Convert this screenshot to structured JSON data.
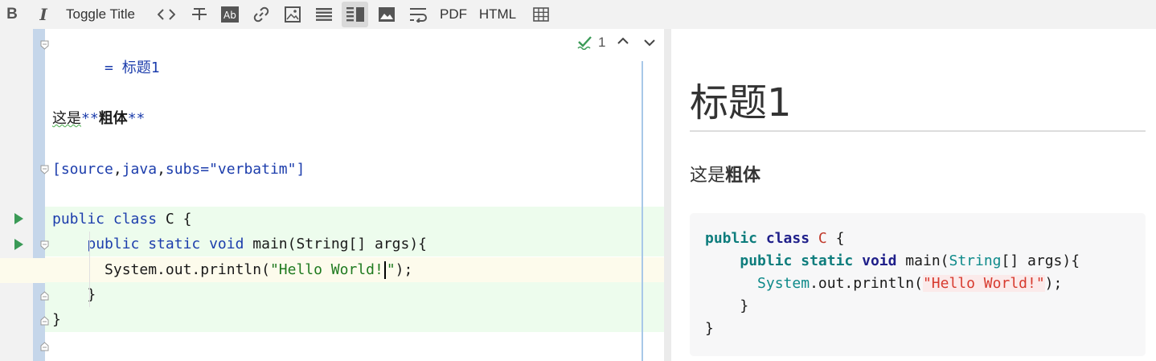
{
  "toolbar": {
    "bold": "B",
    "italic": "I",
    "toggle_title": "Toggle Title",
    "pdf": "PDF",
    "html": "HTML"
  },
  "editor": {
    "heading_line": "= 标题1",
    "para_prefix": "这是",
    "para_bold_open": "**",
    "para_bold_text": "粗体",
    "para_bold_close": "**",
    "attr_open": "[source",
    "attr_c1": ",",
    "attr_java": "java",
    "attr_c2": ",",
    "attr_subs": "subs=\"verbatim\"]",
    "delim_top": "----",
    "code_l1_kw1": "public",
    "code_l1_kw2": "class",
    "code_l1_rest": "C {",
    "code_l2_indent": "    ",
    "code_l2_kw": "public static void",
    "code_l2_rest": "main(String[] args){",
    "code_l3_indent": "      ",
    "code_l3_a": "System.out.println(",
    "code_l3_str1": "\"Hello World!",
    "code_l3_str2": "\"",
    "code_l3_b": ");",
    "code_l4": "    }",
    "code_l5": "}",
    "delim_bottom": "----",
    "inspection_count": "1"
  },
  "preview": {
    "title": "标题1",
    "para_prefix": "这是",
    "para_bold": "粗体",
    "code": {
      "l1_kw1": "public",
      "l1_kw2": "class",
      "l1_cls": "C",
      "l1_rest": " {",
      "l2_indent": "    ",
      "l2_kw1": "public",
      "l2_kw2": "static",
      "l2_kw3": "void",
      "l2_main": " main(",
      "l2_type": "String",
      "l2_rest": "[] args){",
      "l3_indent": "      ",
      "l3_type": "System",
      "l3_mid": ".out.println(",
      "l3_str": "\"Hello World!\"",
      "l3_end": ");",
      "l4": "    }",
      "l5": "}"
    }
  },
  "icons": {
    "bold": "bold-icon",
    "italic": "italic-icon",
    "code": "code-brackets-icon",
    "strike": "strikethrough-icon",
    "ab": "ab-box-icon",
    "link": "link-icon",
    "image": "image-icon",
    "lines": "horizontal-lines-icon",
    "split": "split-layout-icon",
    "picture": "picture-icon",
    "wrap": "soft-wrap-icon",
    "table": "table-icon"
  },
  "colors": {
    "toolbar_bg": "#f2f2f2",
    "code_block_bg": "#edfced",
    "caret_line_bg": "#fdfbec",
    "fold_column": "#c5d6ea",
    "keyword_blue": "#1c3dac",
    "string_green": "#1f7a1f",
    "run_green": "#3a9a56"
  }
}
